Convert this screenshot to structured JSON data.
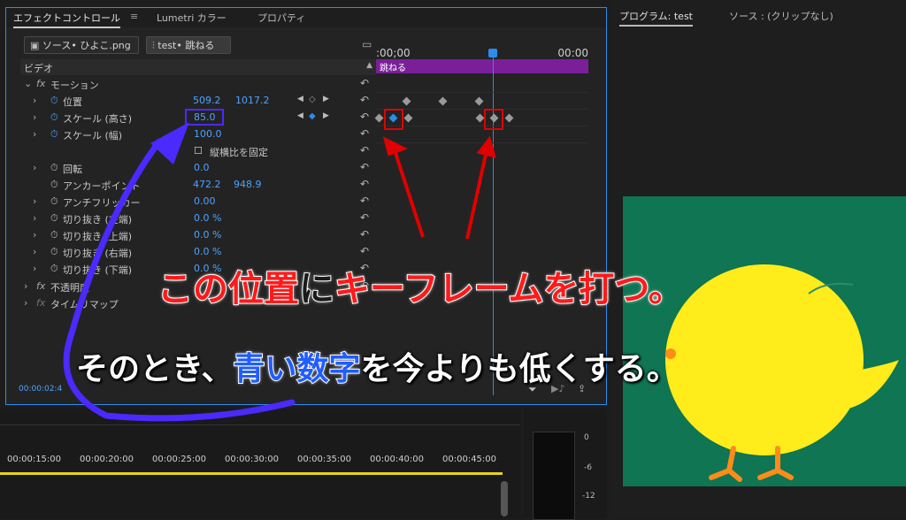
{
  "effect_controls": {
    "tabs": [
      "エフェクトコントロール",
      "Lumetri カラー",
      "プロパティ"
    ],
    "menu_glyph": "≡",
    "source_clip": "ソース• ひよこ.png",
    "sequence_clip": "test• 跳ねる",
    "section": "ビデオ",
    "group": "モーション",
    "fx_label": "fx",
    "properties": [
      {
        "label": "位置",
        "v1": "509.2",
        "v2": "1017.2"
      },
      {
        "label": "スケール (高さ)",
        "v1": "85.0"
      },
      {
        "label": "スケール (幅)",
        "v1": "100.0"
      },
      {
        "label": "縦横比を固定"
      },
      {
        "label": "回転",
        "v1": "0.0"
      },
      {
        "label": "アンカーポイント",
        "v1": "472.2",
        "v2": "948.9"
      },
      {
        "label": "アンチフリッカー",
        "v1": "0.00"
      },
      {
        "label": "切り抜き (左端)",
        "v1": "0.0 %"
      },
      {
        "label": "切り抜き (上端)",
        "v1": "0.0 %"
      },
      {
        "label": "切り抜き (右端)",
        "v1": "0.0 %"
      },
      {
        "label": "切り抜き (下端)",
        "v1": "0.0 %"
      },
      {
        "label": "不透明度"
      },
      {
        "label": "タイムリマップ"
      }
    ],
    "ruler_start": ":00;00",
    "ruler_end": "00:00",
    "clip_bar_label": "跳ねる",
    "timecode": "00:00:02:4"
  },
  "program": {
    "title": "プログラム: test",
    "source_tab": "ソース : (クリップなし)"
  },
  "timeline": {
    "ticks": [
      "00:00:15:00",
      "00:00:20:00",
      "00:00:25:00",
      "00:00:30:00",
      "00:00:35:00",
      "00:00:40:00",
      "00:00:45:00"
    ]
  },
  "audio_meter": {
    "labels": [
      "0",
      "-6",
      "-12"
    ]
  },
  "overlay": {
    "line1_a": "この位置",
    "line1_b": "に",
    "line1_c": "キーフレームを打つ。",
    "line2_a": "そのとき、",
    "line2_b": "青い数字",
    "line2_c": "を今よりも低くする。"
  },
  "colors": {
    "accent_blue": "#2d8ceb",
    "clip_purple": "#7a1f99",
    "annotation_red": "#e00000",
    "arrow_purple": "#4a2aff",
    "video_bg": "#0f7552",
    "chick_yellow": "#ffec1a"
  }
}
